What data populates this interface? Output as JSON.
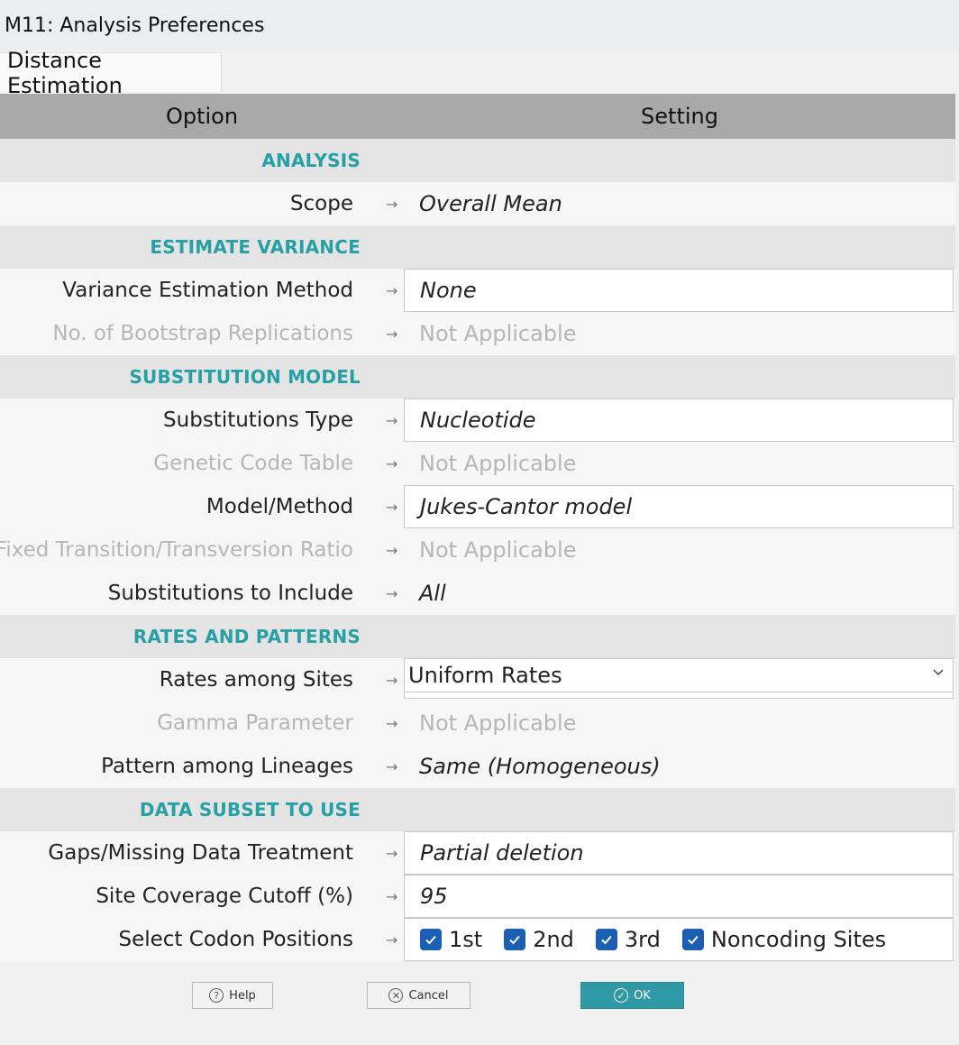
{
  "window": {
    "title": "M11: Analysis Preferences"
  },
  "tabs": [
    {
      "label": "Distance Estimation"
    }
  ],
  "header": {
    "option": "Option",
    "setting": "Setting"
  },
  "sections": {
    "analysis": "ANALYSIS",
    "variance": "ESTIMATE VARIANCE",
    "substitution": "SUBSTITUTION MODEL",
    "rates": "RATES AND PATTERNS",
    "subset": "DATA SUBSET TO USE"
  },
  "rows": {
    "scope": {
      "label": "Scope",
      "value": "Overall Mean"
    },
    "variance_method": {
      "label": "Variance Estimation Method",
      "value": "None"
    },
    "bootstrap": {
      "label": "No. of Bootstrap Replications",
      "value": "Not Applicable"
    },
    "subst_type": {
      "label": "Substitutions Type",
      "value": "Nucleotide"
    },
    "genetic_code": {
      "label": "Genetic Code Table",
      "value": "Not Applicable"
    },
    "model": {
      "label": "Model/Method",
      "value": "Jukes-Cantor model"
    },
    "ts_tv": {
      "label": "Fixed Transition/Transversion Ratio",
      "value": "Not Applicable"
    },
    "subst_include": {
      "label": "Substitutions to Include",
      "value": "All"
    },
    "rates_sites": {
      "label": "Rates among Sites",
      "value": "Uniform Rates"
    },
    "gamma": {
      "label": "Gamma Parameter",
      "value": "Not Applicable"
    },
    "pattern": {
      "label": "Pattern among Lineages",
      "value": "Same (Homogeneous)"
    },
    "gaps": {
      "label": "Gaps/Missing Data Treatment",
      "value": "Partial deletion"
    },
    "coverage": {
      "label": "Site Coverage Cutoff (%)",
      "value": "95"
    },
    "codon": {
      "label": "Select Codon Positions"
    }
  },
  "codon_positions": [
    {
      "label": "1st",
      "checked": true
    },
    {
      "label": "2nd",
      "checked": true
    },
    {
      "label": "3rd",
      "checked": true
    },
    {
      "label": "Noncoding Sites",
      "checked": true
    }
  ],
  "arrow_glyph": "→",
  "buttons": {
    "help": "Help",
    "cancel": "Cancel",
    "ok": "OK"
  },
  "colors": {
    "section_text": "#26a0a4",
    "ok_button": "#2f9aa5",
    "checkbox": "#1a5fb4"
  }
}
